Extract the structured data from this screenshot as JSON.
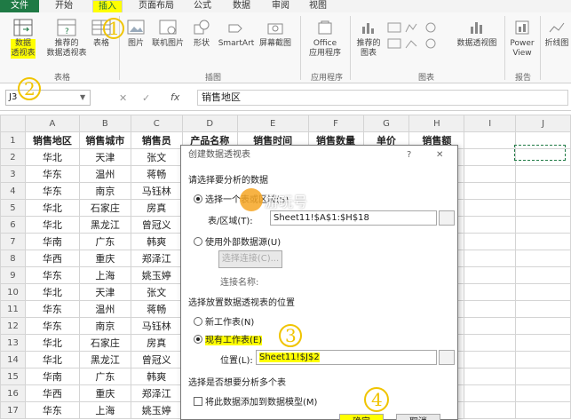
{
  "tabs": [
    "文件",
    "开始",
    "插入",
    "页面布局",
    "公式",
    "数据",
    "审阅",
    "视图"
  ],
  "active_tab_index": 2,
  "ribbon": {
    "buttons": {
      "pivot_table": "数据\n透视表",
      "recommended_pivot": "推荐的\n数据透视表",
      "table": "表格",
      "picture": "图片",
      "online_picture": "联机图片",
      "shapes": "形状",
      "smartart": "SmartArt",
      "screenshot": "屏幕截图",
      "office_apps": "Office\n应用程序",
      "recommended_charts": "推荐的\n图表",
      "pivot_chart": "数据透视图",
      "power_view": "Power\nView",
      "line": "折线图"
    },
    "groups": {
      "tables": "表格",
      "illustrations": "插图",
      "apps": "应用程序",
      "charts": "图表",
      "reports": "报告"
    }
  },
  "formula_bar": {
    "name_box": "J3",
    "formula_value": "销售地区",
    "fx_label": "fx"
  },
  "sheet": {
    "columns": [
      "A",
      "B",
      "C",
      "D",
      "E",
      "F",
      "G",
      "H",
      "I",
      "J"
    ],
    "header_row": [
      "销售地区",
      "销售城市",
      "销售员",
      "产品名称",
      "销售时间",
      "销售数量",
      "单价",
      "销售额"
    ],
    "rows": [
      [
        "华北",
        "天津",
        "张文"
      ],
      [
        "华东",
        "温州",
        "蒋畅"
      ],
      [
        "华东",
        "南京",
        "马钰林"
      ],
      [
        "华北",
        "石家庄",
        "房真"
      ],
      [
        "华北",
        "黑龙江",
        "曾冠义"
      ],
      [
        "华南",
        "广东",
        "韩爽"
      ],
      [
        "华西",
        "重庆",
        "郑泽江"
      ],
      [
        "华东",
        "上海",
        "姚玉婷"
      ],
      [
        "华北",
        "天津",
        "张文"
      ],
      [
        "华东",
        "温州",
        "蒋畅"
      ],
      [
        "华东",
        "南京",
        "马钰林"
      ],
      [
        "华北",
        "石家庄",
        "房真"
      ],
      [
        "华北",
        "黑龙江",
        "曾冠义"
      ],
      [
        "华南",
        "广东",
        "韩爽"
      ],
      [
        "华西",
        "重庆",
        "郑泽江"
      ],
      [
        "华东",
        "上海",
        "姚玉婷"
      ]
    ],
    "row_numbers": [
      "1",
      "2",
      "3",
      "4",
      "5",
      "6",
      "7",
      "8",
      "9",
      "10",
      "11",
      "12",
      "13",
      "14",
      "15",
      "16",
      "17"
    ]
  },
  "dialog": {
    "title": "创建数据透视表",
    "help": "?",
    "close": "✕",
    "section1": "请选择要分析的数据",
    "opt_range": "选择一个表或区域(S)",
    "range_label": "表/区域(T):",
    "range_value": "Sheet11!$A$1:$H$18",
    "opt_external": "使用外部数据源(U)",
    "choose_conn": "选择连接(C)...",
    "conn_name": "连接名称:",
    "section2": "选择放置数据透视表的位置",
    "opt_new": "新工作表(N)",
    "opt_existing": "现有工作表(E)",
    "location_label": "位置(L):",
    "location_value": "Sheet11!$J$2",
    "section3": "选择是否想要分析多个表",
    "add_model": "将此数据添加到数据模型(M)",
    "ok": "确定",
    "cancel": "取消"
  },
  "annotations": [
    "1",
    "2",
    "3",
    "4"
  ],
  "watermark": "游玩号",
  "colors": {
    "accent": "#1f7a45",
    "highlight": "#ffff00",
    "annotation": "#f0c400"
  }
}
